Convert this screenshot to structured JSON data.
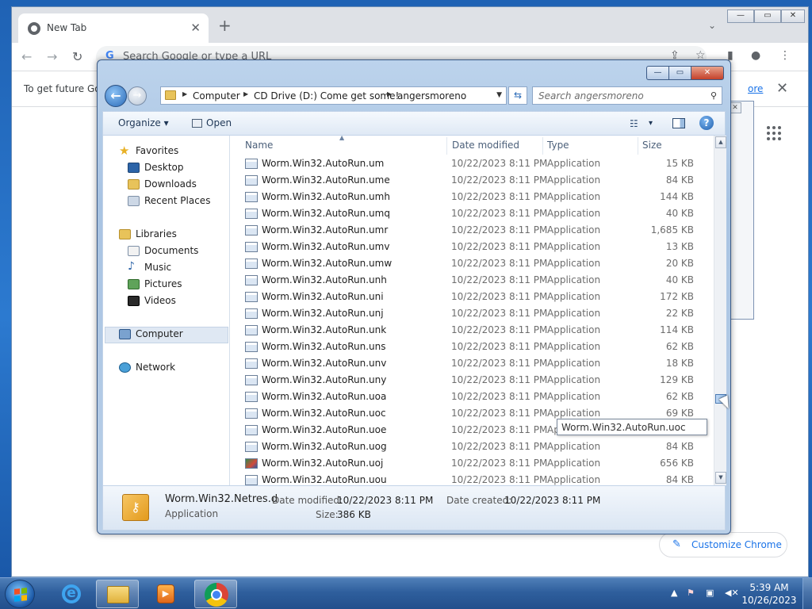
{
  "chrome": {
    "tab_title": "New Tab",
    "tab_close": "✕",
    "new_tab": "+",
    "tab_search": "⌄",
    "win_min": "—",
    "win_max": "▭",
    "win_close": "✕",
    "omnibox_g": "G",
    "omnibox_placeholder": "Search Google or type a URL",
    "infobar_message": "To get future Go",
    "infobar_more": "ore",
    "infobar_close": "✕",
    "customize_label": "Customize Chrome"
  },
  "explorer": {
    "breadcrumb": [
      "Computer",
      "CD Drive (D:) Come get some!",
      "angersmoreno"
    ],
    "search_placeholder": "Search angersmoreno",
    "toolbar": {
      "organize": "Organize ▾",
      "open": "Open",
      "view_menu": "▾"
    },
    "nav_favorites": {
      "header": "Favorites",
      "items": [
        "Desktop",
        "Downloads",
        "Recent Places"
      ]
    },
    "nav_libraries": {
      "header": "Libraries",
      "items": [
        "Documents",
        "Music",
        "Pictures",
        "Videos"
      ]
    },
    "nav_computer": "Computer",
    "nav_network": "Network",
    "columns": {
      "name": "Name",
      "date": "Date modified",
      "type": "Type",
      "size": "Size"
    },
    "files": [
      {
        "name": "Worm.Win32.AutoRun.um",
        "date": "10/22/2023 8:11 PM",
        "type": "Application",
        "size": "15 KB"
      },
      {
        "name": "Worm.Win32.AutoRun.ume",
        "date": "10/22/2023 8:11 PM",
        "type": "Application",
        "size": "84 KB"
      },
      {
        "name": "Worm.Win32.AutoRun.umh",
        "date": "10/22/2023 8:11 PM",
        "type": "Application",
        "size": "144 KB"
      },
      {
        "name": "Worm.Win32.AutoRun.umq",
        "date": "10/22/2023 8:11 PM",
        "type": "Application",
        "size": "40 KB"
      },
      {
        "name": "Worm.Win32.AutoRun.umr",
        "date": "10/22/2023 8:11 PM",
        "type": "Application",
        "size": "1,685 KB"
      },
      {
        "name": "Worm.Win32.AutoRun.umv",
        "date": "10/22/2023 8:11 PM",
        "type": "Application",
        "size": "13 KB"
      },
      {
        "name": "Worm.Win32.AutoRun.umw",
        "date": "10/22/2023 8:11 PM",
        "type": "Application",
        "size": "20 KB"
      },
      {
        "name": "Worm.Win32.AutoRun.unh",
        "date": "10/22/2023 8:11 PM",
        "type": "Application",
        "size": "40 KB"
      },
      {
        "name": "Worm.Win32.AutoRun.uni",
        "date": "10/22/2023 8:11 PM",
        "type": "Application",
        "size": "172 KB"
      },
      {
        "name": "Worm.Win32.AutoRun.unj",
        "date": "10/22/2023 8:11 PM",
        "type": "Application",
        "size": "22 KB"
      },
      {
        "name": "Worm.Win32.AutoRun.unk",
        "date": "10/22/2023 8:11 PM",
        "type": "Application",
        "size": "114 KB"
      },
      {
        "name": "Worm.Win32.AutoRun.uns",
        "date": "10/22/2023 8:11 PM",
        "type": "Application",
        "size": "62 KB"
      },
      {
        "name": "Worm.Win32.AutoRun.unv",
        "date": "10/22/2023 8:11 PM",
        "type": "Application",
        "size": "18 KB"
      },
      {
        "name": "Worm.Win32.AutoRun.uny",
        "date": "10/22/2023 8:11 PM",
        "type": "Application",
        "size": "129 KB"
      },
      {
        "name": "Worm.Win32.AutoRun.uoa",
        "date": "10/22/2023 8:11 PM",
        "type": "Application",
        "size": "62 KB"
      },
      {
        "name": "Worm.Win32.AutoRun.uoc",
        "date": "10/22/2023 8:11 PM",
        "type": "Application",
        "size": "69 KB"
      },
      {
        "name": "Worm.Win32.AutoRun.uoe",
        "date": "10/22/2023 8:11 PM",
        "type": "Ap",
        "size": ""
      },
      {
        "name": "Worm.Win32.AutoRun.uog",
        "date": "10/22/2023 8:11 PM",
        "type": "Application",
        "size": "84 KB"
      },
      {
        "name": "Worm.Win32.AutoRun.uoj",
        "date": "10/22/2023 8:11 PM",
        "type": "Application",
        "size": "656 KB"
      },
      {
        "name": "Worm.Win32.AutoRun.uou",
        "date": "10/22/2023 8:11 PM",
        "type": "Application",
        "size": "84 KB"
      }
    ],
    "tooltip": "Worm.Win32.AutoRun.uoc",
    "details": {
      "name": "Worm.Win32.Netres.d",
      "type": "Application",
      "date_modified_label": "Date modified:",
      "date_modified": "10/22/2023 8:11 PM",
      "date_created_label": "Date created:",
      "date_created": "10/22/2023 8:11 PM",
      "size_label": "Size:",
      "size": "386 KB"
    }
  },
  "taskbar": {
    "clock_time": "5:39 AM",
    "clock_date": "10/26/2023"
  },
  "colors": {
    "accent": "#1a73e8",
    "explorer_frame": "#a8c3e2",
    "taskbar": "#2f5f9d"
  }
}
